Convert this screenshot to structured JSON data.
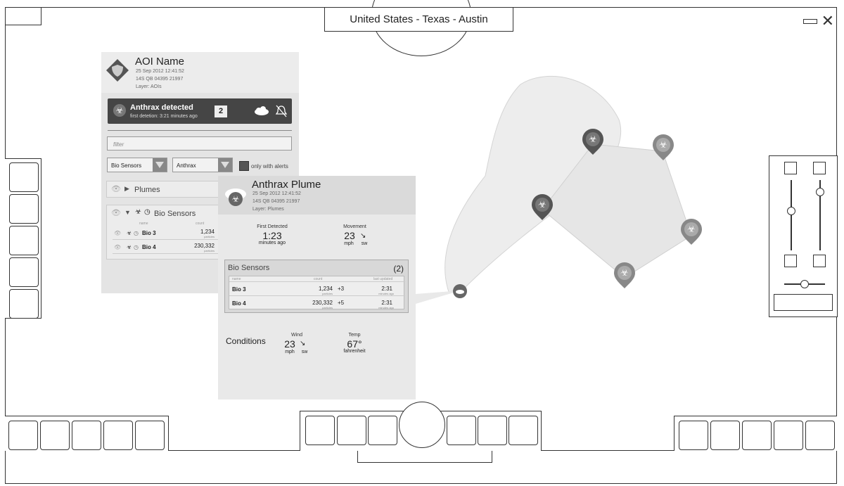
{
  "location": "United States - Texas - Austin",
  "aoi": {
    "title": "AOI Name",
    "date": "25 Sep 2012 12:41:52",
    "grid": "14S QB 04395 21997",
    "layer": "Layer: AOIs",
    "alert_title": "Anthrax detected",
    "alert_sub": "first detetion: 3:21 minutes ago",
    "alert_count": "2",
    "filter_placeholder": "filter",
    "dropdown1": "Bio Sensors",
    "dropdown2": "Anthrax",
    "only_alerts_label": "only with alerts",
    "plumes_label": "Plumes",
    "bio_sensors_label": "Bio Sensors",
    "table_headers": [
      "name",
      "count"
    ],
    "rows": [
      {
        "name": "Bio 3",
        "count": "1,234",
        "unit": "particles"
      },
      {
        "name": "Bio 4",
        "count": "230,332",
        "unit": "particles"
      }
    ]
  },
  "plume": {
    "title": "Anthrax Plume",
    "date": "25 Sep 2012 12:41:52",
    "grid": "14S QB 04395 21997",
    "layer": "Layer: Plumes",
    "first_detected_label": "First Detected",
    "first_detected_value": "1:23",
    "first_detected_unit": "minutes ago",
    "movement_label": "Movement",
    "movement_value": "23",
    "movement_unit": "mph",
    "movement_dir": "sw",
    "bio_sensors_title": "Bio Sensors",
    "bio_sensors_count": "(2)",
    "table_headers": [
      "name",
      "count",
      "last updated"
    ],
    "rows": [
      {
        "name": "Bio 3",
        "count": "1,234",
        "unit": "particles",
        "delta": "+3",
        "time": "2:31",
        "time_unit": "minutes ago"
      },
      {
        "name": "Bio 4",
        "count": "230,332",
        "unit": "particles",
        "delta": "+5",
        "time": "2:31",
        "time_unit": "minutes ago"
      }
    ],
    "conditions_label": "Conditions",
    "wind_label": "Wind",
    "wind_value": "23",
    "wind_unit": "mph",
    "wind_dir": "sw",
    "temp_label": "Temp",
    "temp_value": "67°",
    "temp_unit": "fahrenheit"
  },
  "map_markers": [
    "biohazard-pin",
    "biohazard-pin",
    "biohazard-pin",
    "biohazard-pin",
    "biohazard-pin",
    "plume-origin"
  ]
}
